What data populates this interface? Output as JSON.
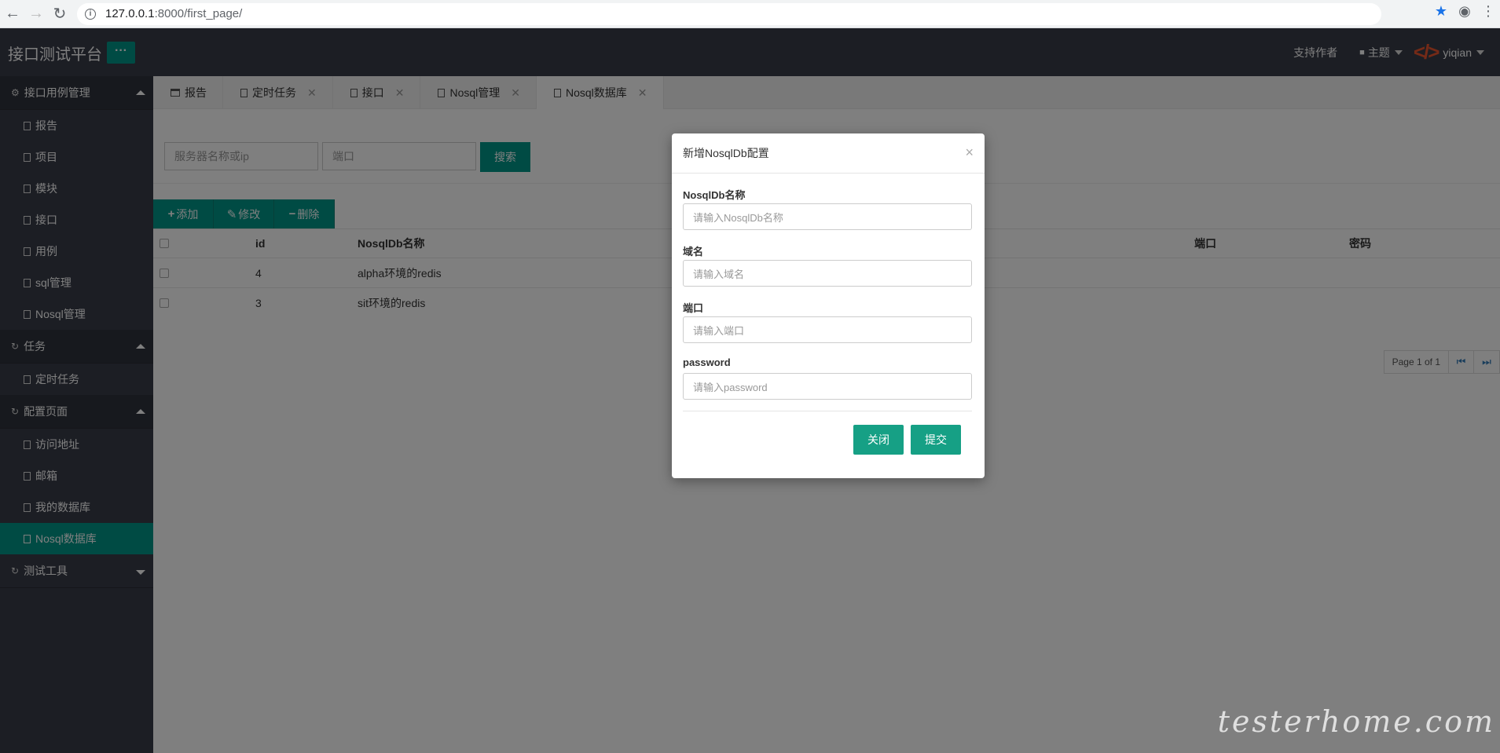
{
  "browser": {
    "url_host": "127.0.0.1",
    "url_rest": ":8000/first_page/"
  },
  "header": {
    "app_title": "接口测试平台",
    "menu_toggle": "···",
    "support": "支持作者",
    "theme": "主题",
    "user": "yiqian"
  },
  "sidebar": {
    "groups": [
      {
        "label": "接口用例管理",
        "items": [
          "报告",
          "项目",
          "模块",
          "接口",
          "用例",
          "sql管理",
          "Nosql管理"
        ]
      },
      {
        "label": "任务",
        "items": [
          "定时任务"
        ]
      },
      {
        "label": "配置页面",
        "items": [
          "访问地址",
          "邮箱",
          "我的数据库",
          "Nosql数据库"
        ]
      },
      {
        "label": "测试工具",
        "items": []
      }
    ]
  },
  "tabs": [
    "报告",
    "定时任务",
    "接口",
    "Nosql管理",
    "Nosql数据库"
  ],
  "search": {
    "server_placeholder": "服务器名称或ip",
    "port_placeholder": "端口",
    "button": "搜索"
  },
  "toolbar": {
    "add": "添加",
    "edit": "修改",
    "delete": "删除"
  },
  "table": {
    "columns": [
      "id",
      "NosqlDb名称",
      "端口",
      "密码"
    ],
    "rows": [
      {
        "id": "4",
        "name": "alpha环境的redis",
        "port": "",
        "password": ""
      },
      {
        "id": "3",
        "name": "sit环境的redis",
        "port": "",
        "password": ""
      }
    ]
  },
  "pager": {
    "info": "Page 1 of 1"
  },
  "modal": {
    "title": "新增NosqlDb配置",
    "fields": [
      {
        "label": "NosqlDb名称",
        "placeholder": "请输入NosqlDb名称"
      },
      {
        "label": "域名",
        "placeholder": "请输入域名"
      },
      {
        "label": "端口",
        "placeholder": "请输入端口"
      },
      {
        "label": "password",
        "placeholder": "请输入password"
      }
    ],
    "close_button": "关闭",
    "submit_button": "提交"
  },
  "watermark": "testerhome.com",
  "colors": {
    "primary": "#009688",
    "header_bg": "#393d49",
    "logo": "#e8542f"
  }
}
